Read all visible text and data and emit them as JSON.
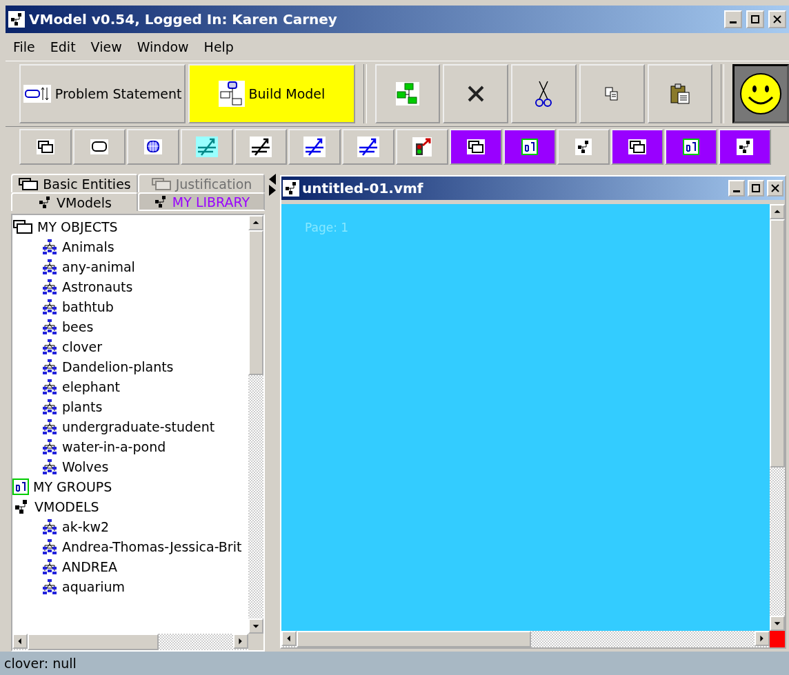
{
  "window": {
    "title": "VModel v0.54, Logged In: Karen Carney"
  },
  "menu": [
    "File",
    "Edit",
    "View",
    "Window",
    "Help"
  ],
  "main_toolbar": [
    {
      "label": "Problem Statement",
      "selected": false
    },
    {
      "label": "Build Model",
      "selected": true
    }
  ],
  "object_toolbar": [
    {
      "highlighted": false
    },
    {
      "highlighted": false
    },
    {
      "highlighted": false
    },
    {
      "highlighted": false
    },
    {
      "highlighted": false
    },
    {
      "highlighted": false
    },
    {
      "highlighted": false
    },
    {
      "highlighted": false
    },
    {
      "highlighted": true
    },
    {
      "highlighted": true
    },
    {
      "highlighted": false
    },
    {
      "highlighted": true
    },
    {
      "highlighted": true
    },
    {
      "highlighted": true
    }
  ],
  "tabs_top": [
    {
      "label": "Basic Entities",
      "disabled": false
    },
    {
      "label": "Justification",
      "disabled": true
    }
  ],
  "tabs_bottom": [
    {
      "label": "VModels",
      "selected": true,
      "color": "#000000"
    },
    {
      "label": "MY LIBRARY",
      "selected": false,
      "color": "#9900ff"
    }
  ],
  "tree": [
    {
      "label": "MY OBJECTS",
      "kind": "objects",
      "children": [
        {
          "label": "Animals"
        },
        {
          "label": "any-animal"
        },
        {
          "label": "Astronauts"
        },
        {
          "label": "bathtub"
        },
        {
          "label": "bees"
        },
        {
          "label": "clover"
        },
        {
          "label": "Dandelion-plants"
        },
        {
          "label": "elephant"
        },
        {
          "label": "plants"
        },
        {
          "label": "undergraduate-student"
        },
        {
          "label": "water-in-a-pond"
        },
        {
          "label": "Wolves"
        }
      ]
    },
    {
      "label": "MY GROUPS",
      "kind": "groups"
    },
    {
      "label": "VMODELS",
      "kind": "vmodels",
      "children": [
        {
          "label": "ak-kw2"
        },
        {
          "label": "Andrea-Thomas-Jessica-Brit"
        },
        {
          "label": "ANDREA"
        },
        {
          "label": "aquarium"
        }
      ]
    }
  ],
  "document": {
    "title": "untitled-01.vmf",
    "page_label": "Page: 1"
  },
  "status_bar": "clover: null"
}
